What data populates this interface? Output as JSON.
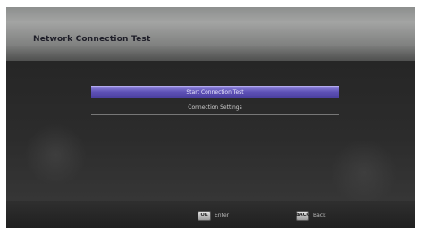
{
  "header": {
    "title": "Network Connection Test",
    "subtitle": "",
    "right_info": ""
  },
  "menu": {
    "items": [
      {
        "label": "Start Connection Test",
        "value": "",
        "selected": true
      },
      {
        "label": "Connection Settings",
        "value": "",
        "selected": false
      }
    ]
  },
  "footer": {
    "buttons": [
      {
        "key": "OK",
        "label": "Enter"
      },
      {
        "key": "BACK",
        "label": "Back"
      }
    ]
  }
}
